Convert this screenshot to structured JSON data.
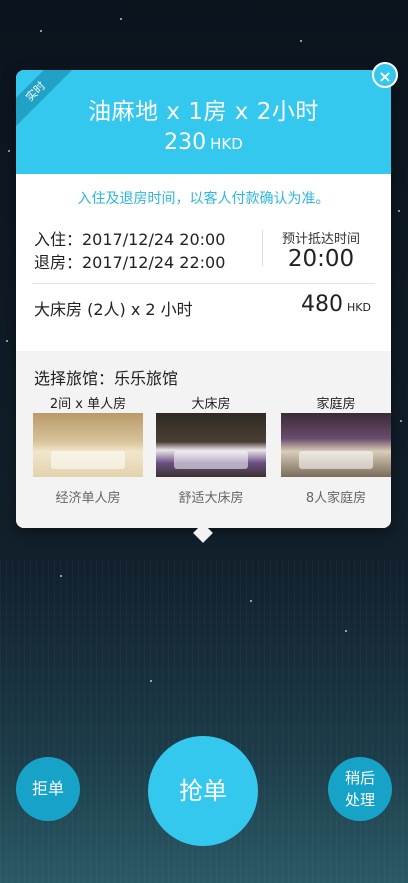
{
  "order": {
    "badge": "实时",
    "title": "油麻地 x 1房 x 2小时",
    "price": "230",
    "currency": "HKD",
    "close_icon": "×"
  },
  "notice": "入住及退房时间，以客人付款确认为准。",
  "stay": {
    "checkin": "入住：2017/12/24 20:00",
    "checkout": "退房：2017/12/24 22:00",
    "eta_label": "预计抵达时间",
    "eta_time": "20:00"
  },
  "room": {
    "description": "大床房 (2人) x 2 小时",
    "price": "480",
    "currency": "HKD"
  },
  "hotel": {
    "title": "选择旅馆：乐乐旅馆",
    "rooms": [
      {
        "type": "2间 x 单人房",
        "caption": "经济单人房"
      },
      {
        "type": "大床房",
        "caption": "舒适大床房"
      },
      {
        "type": "家庭房",
        "caption": "8人家庭房"
      }
    ]
  },
  "actions": {
    "reject": "拒单",
    "grab": "抢单",
    "later_line1": "稍后",
    "later_line2": "处理"
  },
  "colors": {
    "accent": "#35c8ef",
    "accent_dark": "#17a3c8"
  }
}
